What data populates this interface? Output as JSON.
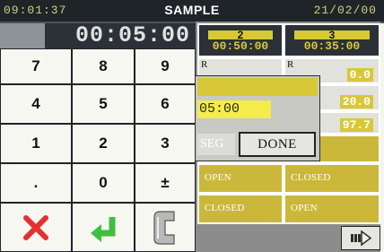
{
  "titlebar": {
    "time": "09:01:37",
    "title": "SAMPLE",
    "date": "21/02/00"
  },
  "keypad": {
    "display": "00:05:00",
    "keys": [
      "7",
      "8",
      "9",
      "4",
      "5",
      "6",
      "1",
      "2",
      "3",
      ".",
      "0",
      "±"
    ],
    "cancel_icon": "close-icon",
    "enter_icon": "enter-icon",
    "clear_label": "C"
  },
  "segments": [
    {
      "number": "2",
      "time": "00:50:00"
    },
    {
      "number": "3",
      "time": "00:35:00"
    }
  ],
  "values": [
    {
      "prefix": "R",
      "value": "0.0"
    },
    {
      "prefix": "R",
      "value": "20.0"
    },
    {
      "prefix": "",
      "value": "97.7"
    }
  ],
  "events": [
    {
      "label": "OPEN"
    },
    {
      "label": "CLOSED"
    },
    {
      "label": "CLOSED"
    },
    {
      "label": "OPEN"
    }
  ],
  "dialog": {
    "field_value": "05:00",
    "seg_label": "SEG",
    "done_label": "DONE"
  },
  "nav": {
    "next_icon": "next-arrow-icon"
  },
  "colors": {
    "accent": "#d8c838",
    "dark": "#2b3137",
    "field": "#f4ec4a",
    "cancel": "#e53030",
    "enter": "#3fbf3f"
  }
}
